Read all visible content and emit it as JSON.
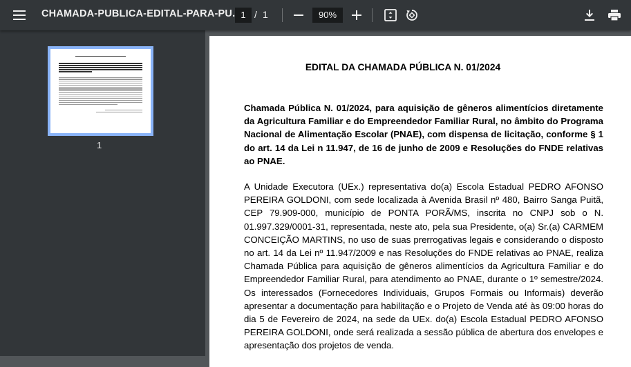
{
  "toolbar": {
    "menu_icon": "hamburger-menu-icon",
    "title": "CHAMADA-PUBLICA-EDITAL-PARA-PU...",
    "current_page": "1",
    "page_separator": "/",
    "total_pages": "1",
    "zoom_level": "90%",
    "zoom_out_icon": "minus-icon",
    "zoom_in_icon": "plus-icon",
    "fit_page_icon": "fit-to-page-icon",
    "rotate_icon": "rotate-icon",
    "download_icon": "download-icon",
    "print_icon": "print-icon"
  },
  "sidebar": {
    "thumbnails": [
      {
        "page_label": "1",
        "selected": true
      }
    ]
  },
  "document": {
    "title": "EDITAL DA CHAMADA PÚBLICA N. 01/2024",
    "intro": "Chamada Pública N. 01/2024, para aquisição de gêneros alimentícios diretamente da Agricultura Familiar e do Empreendedor Familiar Rural, no âmbito do Programa Nacional de Alimentação Escolar (PNAE), com dispensa de licitação, conforme § 1 do art. 14 da Lei n 11.947, de 16 de junho de 2009 e Resoluções do FNDE relativas ao PNAE.",
    "body": "A Unidade Executora (UEx.) representativa do(a) Escola Estadual PEDRO AFONSO PEREIRA GOLDONI, com sede localizada à Avenida Brasil nº 480, Bairro Sanga Puitã, CEP 79.909-000, município de PONTA PORÃ/MS, inscrita no CNPJ sob o N. 01.997.329/0001-31, representada, neste ato, pela sua Presidente, o(a) Sr.(a) CARMEM CONCEIÇÃO MARTINS, no uso de suas prerrogativas legais e considerando o disposto no art. 14 da Lei nº 11.947/2009 e nas Resoluções do FNDE relativas ao PNAE, realiza Chamada Pública para aquisição de gêneros alimentícios da Agricultura Familiar e do Empreendedor Familiar Rural, para atendimento ao PNAE, durante o 1º semestre/2024. Os interessados (Fornecedores Individuais, Grupos Formais ou Informais) deverão apresentar a documentação para habilitação e o Projeto de Venda até às 09:00 horas do dia 5 de Fevereiro de 2024, na sede da UEx. do(a) Escola Estadual PEDRO AFONSO PEREIRA GOLDONI, onde será realizada a sessão pública de abertura dos envelopes e apresentação dos projetos de venda."
  },
  "colors": {
    "toolbar_bg": "#323639",
    "viewer_bg": "#525659",
    "thumbnail_selected_border": "#8ab4f8"
  }
}
